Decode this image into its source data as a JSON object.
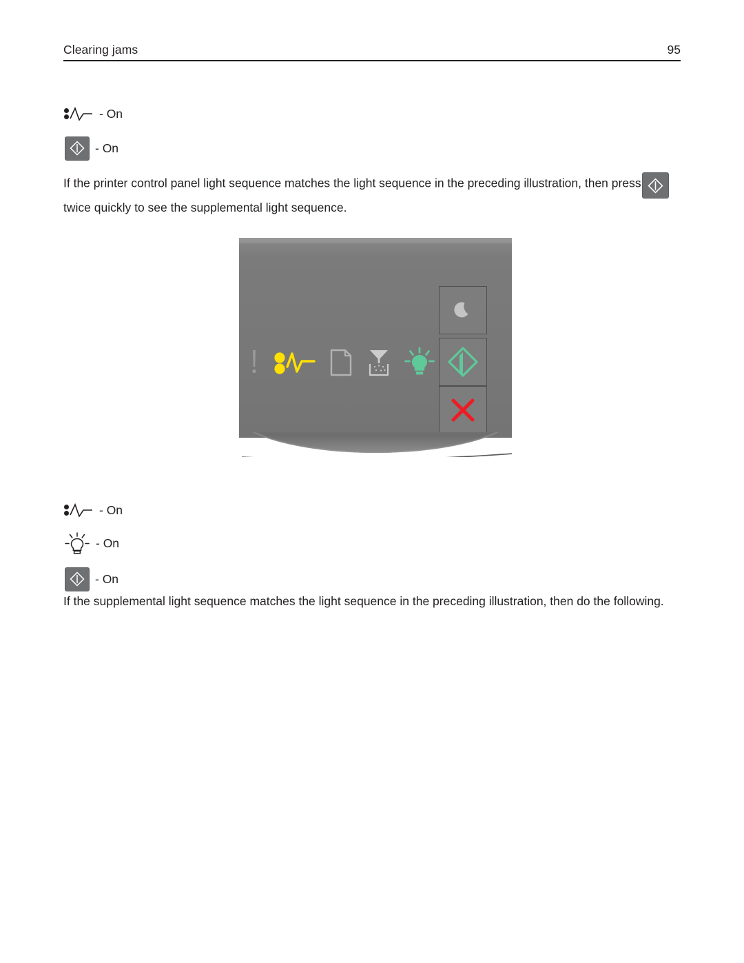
{
  "header": {
    "title": "Clearing jams",
    "page_number": "95"
  },
  "light_sequence_primary": {
    "items": [
      {
        "icon": "paper-jam-icon",
        "state_label": "- On"
      },
      {
        "icon": "start-button-icon",
        "state_label": "- On"
      }
    ]
  },
  "paragraphs": {
    "instruction_before_button": "If the printer control panel light sequence matches the light sequence in the preceding illustration, then press",
    "instruction_after_button": "twice quickly to see the supplemental light sequence.",
    "supplemental_instruction": "If the supplemental light sequence matches the light sequence in the preceding illustration, then do the following."
  },
  "control_panel": {
    "name": "printer-control-panel-illustration",
    "background_color": "#7a7a7a",
    "indicator_lights": [
      {
        "name": "error-icon",
        "symbol": "!",
        "state": "off",
        "color": "#9a9a9a"
      },
      {
        "name": "paper-jam-icon",
        "symbol": "jam",
        "state": "on",
        "color": "#ffe000"
      },
      {
        "name": "paper-icon",
        "symbol": "page",
        "state": "off",
        "color": "#b0b0b0"
      },
      {
        "name": "toner-icon",
        "symbol": "toner",
        "state": "off",
        "color": "#c8c8c8"
      },
      {
        "name": "lightbulb-icon",
        "symbol": "bulb",
        "state": "on",
        "color": "#5fc99a"
      }
    ],
    "buttons": [
      {
        "name": "sleep-button",
        "symbol": "moon",
        "color": "#c4c4c4"
      },
      {
        "name": "start-button",
        "symbol": "diamond-start",
        "color": "#5fc99a"
      },
      {
        "name": "stop-cancel-button",
        "symbol": "x",
        "color": "#ed1c24"
      }
    ]
  },
  "light_sequence_supplemental": {
    "items": [
      {
        "icon": "paper-jam-icon",
        "state_label": "- On"
      },
      {
        "icon": "lightbulb-icon",
        "state_label": "- On"
      },
      {
        "icon": "start-button-icon",
        "state_label": "- On"
      }
    ]
  }
}
